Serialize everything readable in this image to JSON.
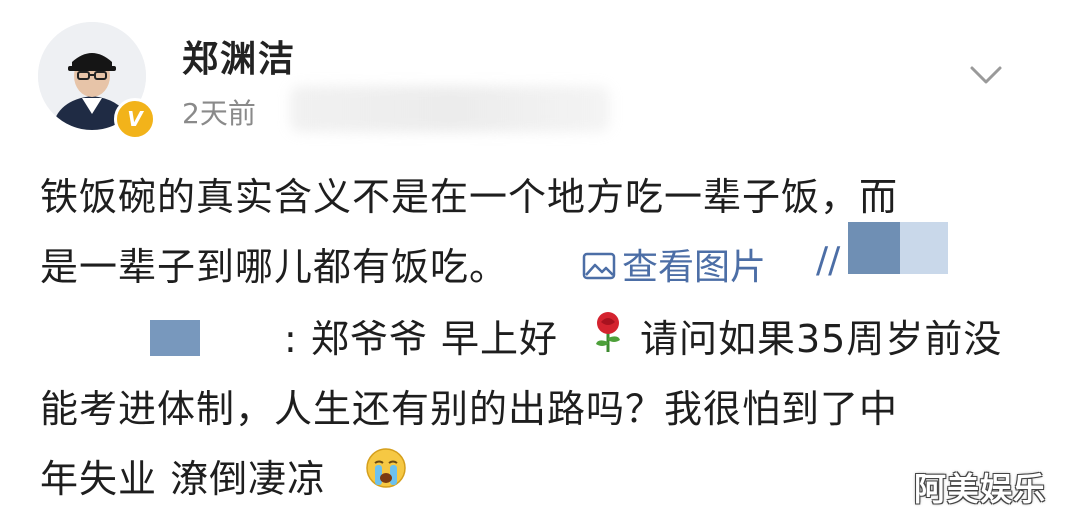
{
  "post": {
    "author": "郑渊洁",
    "time": "2天前",
    "text_line1": "铁饭碗的真实含义不是在一个地方吃一辈子饭，而",
    "text_line2": "是一辈子到哪儿都有饭吃。",
    "view_pic_label": "查看图片",
    "separator": "//",
    "reply_line1_a": ": 郑爷爷 早上好",
    "reply_line1_b": "请问如果35周岁前没",
    "reply_line2": "能考进体制，人生还有别的出路吗？我很怕到了中",
    "reply_line3": "年失业 潦倒凄凉",
    "verified_badge": "V"
  },
  "watermark": "阿美娱乐",
  "icons": {
    "avatar": "avatar-photo",
    "verified": "verified-v-badge-icon",
    "more": "chevron-down-icon",
    "picture": "picture-icon",
    "rose": "rose-emoji-icon",
    "cry": "crying-face-emoji-icon"
  },
  "colors": {
    "link": "#4c6ea6",
    "badge": "#f2b31a",
    "text": "#1e1e1e",
    "muted": "#8a8a8a"
  }
}
